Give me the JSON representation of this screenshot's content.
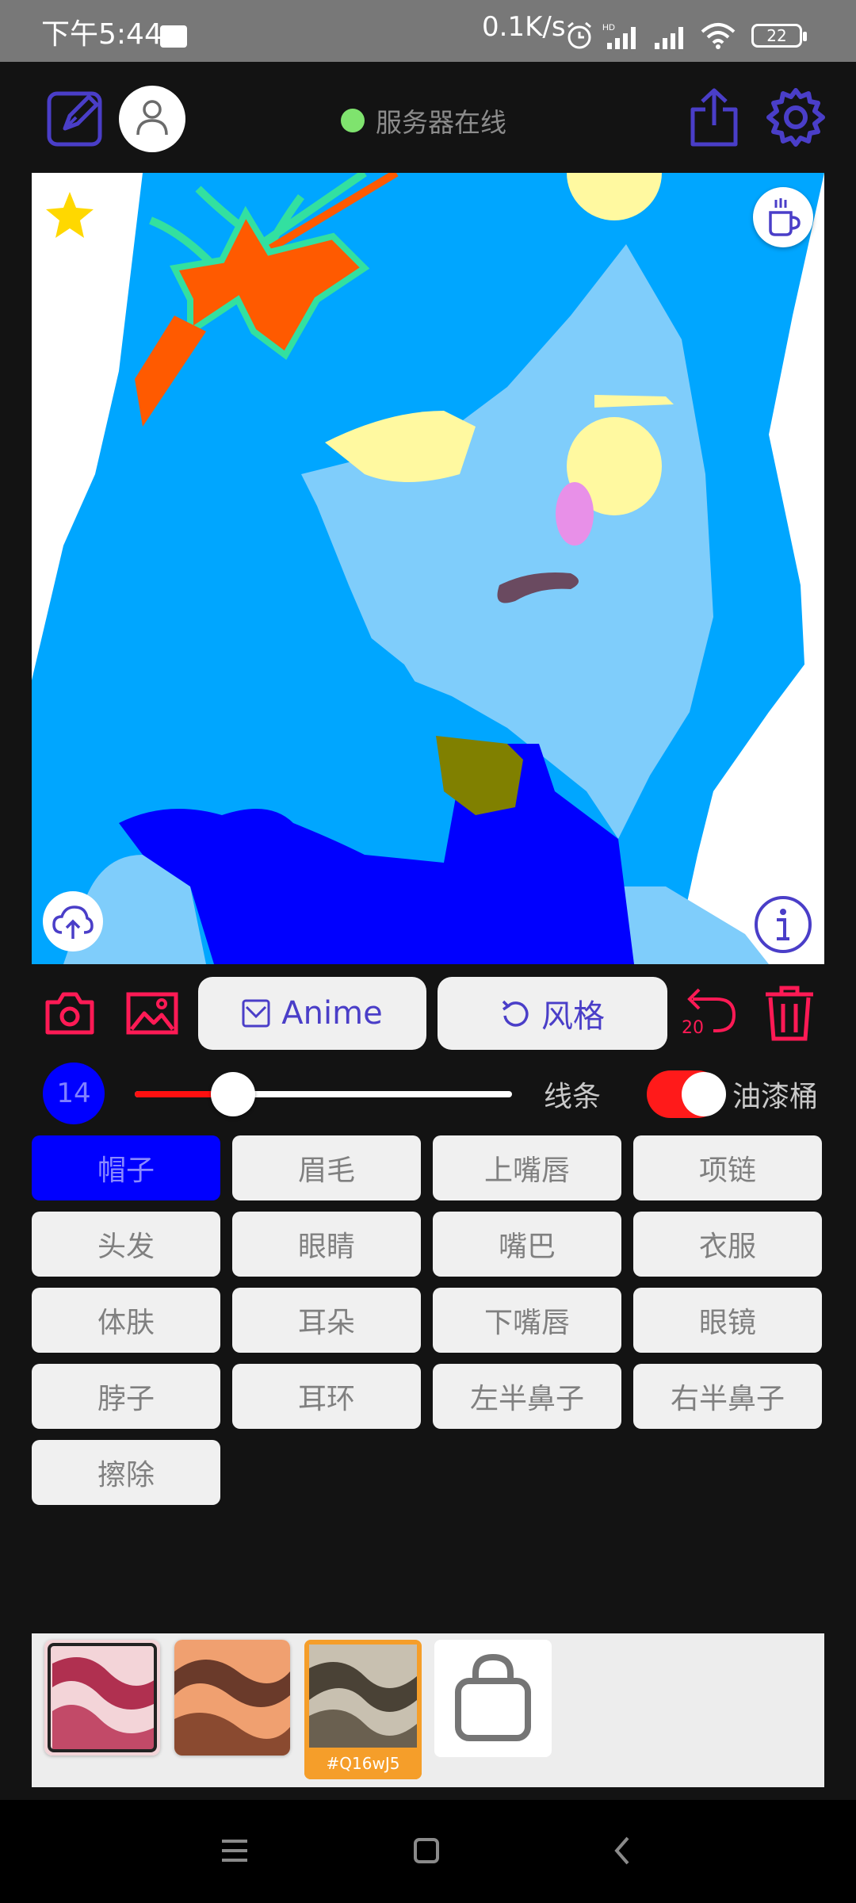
{
  "status_bar": {
    "time": "下午5:44",
    "net_speed": "0.1K/s",
    "battery": "22",
    "icons": [
      "message-icon",
      "alarm-icon",
      "hd-signal-icon",
      "signal-icon",
      "wifi-icon",
      "battery-icon"
    ]
  },
  "header": {
    "server_status": "服务器在线",
    "icons": [
      "edit-icon",
      "user-icon",
      "share-icon",
      "gear-icon"
    ]
  },
  "canvas": {
    "icons": [
      "star-icon",
      "coffee-icon",
      "cloud-upload-icon",
      "info-icon"
    ]
  },
  "toolbar": {
    "anime_label": "Anime",
    "style_label": "风格",
    "undo_count": "20",
    "icons": [
      "camera-icon",
      "image-icon",
      "undo-icon",
      "trash-icon"
    ]
  },
  "brush": {
    "size": "14",
    "slider_fraction": 0.26,
    "line_label": "线条",
    "bucket_toggle_on": true,
    "bucket_label": "油漆桶"
  },
  "parts": [
    {
      "label": "帽子",
      "selected": true
    },
    {
      "label": "眉毛"
    },
    {
      "label": "上嘴唇"
    },
    {
      "label": "项链"
    },
    {
      "label": "头发"
    },
    {
      "label": "眼睛"
    },
    {
      "label": "嘴巴"
    },
    {
      "label": "衣服"
    },
    {
      "label": "体肤"
    },
    {
      "label": "耳朵"
    },
    {
      "label": "下嘴唇"
    },
    {
      "label": "眼镜"
    },
    {
      "label": "脖子"
    },
    {
      "label": "耳环"
    },
    {
      "label": "左半鼻子"
    },
    {
      "label": "右半鼻子"
    },
    {
      "label": "擦除"
    }
  ],
  "styles": {
    "selected_code": "#Q16wJ5",
    "icons": [
      "shopping-bag-icon"
    ]
  },
  "colors": {
    "accent": "#4a3ec8",
    "danger": "#ff1a55",
    "selected_part": "#0000ff",
    "hair": "#00a6ff",
    "skin": "#7fcdfb",
    "clothes": "#0000ff",
    "thumb_selected": "#f59e2a"
  },
  "navbar": {
    "icons": [
      "menu-icon",
      "home-icon",
      "back-icon"
    ]
  }
}
